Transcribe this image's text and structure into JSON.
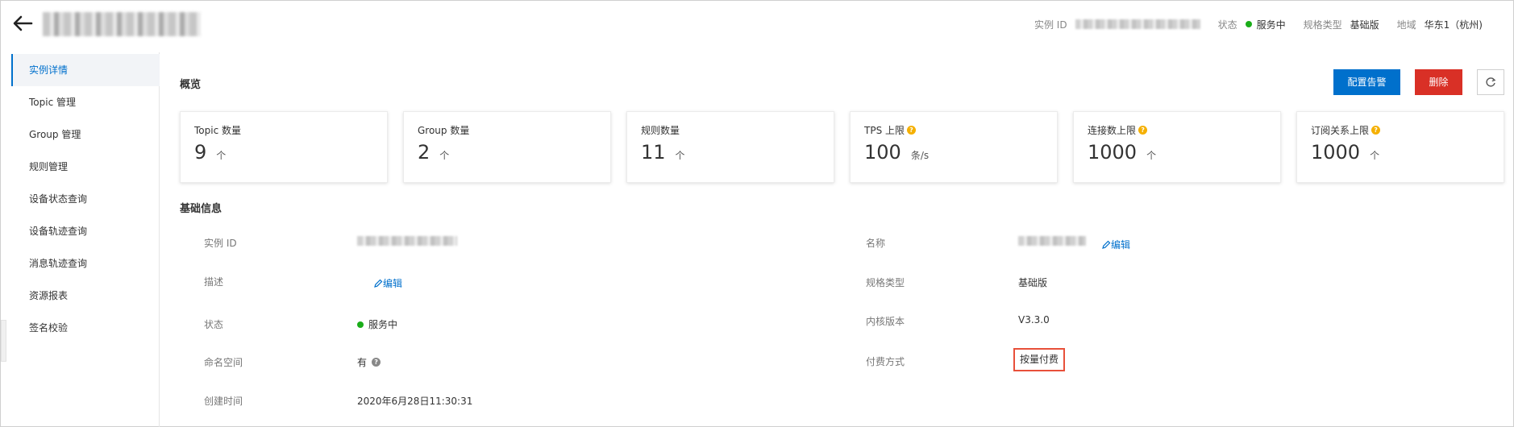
{
  "header": {
    "back_icon": "arrow-left-icon",
    "meta": {
      "instance_id_label": "实例 ID",
      "status_label": "状态",
      "status_value": "服务中",
      "status_color": "#1aad19",
      "spec_label": "规格类型",
      "spec_value": "基础版",
      "region_label": "地域",
      "region_value": "华东1（杭州)"
    }
  },
  "sidebar": {
    "items": [
      {
        "label": "实例详情",
        "active": true
      },
      {
        "label": "Topic 管理"
      },
      {
        "label": "Group 管理"
      },
      {
        "label": "规则管理"
      },
      {
        "label": "设备状态查询"
      },
      {
        "label": "设备轨迹查询"
      },
      {
        "label": "消息轨迹查询"
      },
      {
        "label": "资源报表"
      },
      {
        "label": "签名校验"
      }
    ]
  },
  "overview": {
    "title": "概览",
    "buttons": {
      "alert": "配置告警",
      "delete": "删除",
      "refresh_icon": "refresh-icon"
    },
    "accent_blue": "#0070cc",
    "danger_red": "#d93026",
    "stats": [
      {
        "label": "Topic 数量",
        "value": "9",
        "unit": "个",
        "help": false
      },
      {
        "label": "Group 数量",
        "value": "2",
        "unit": "个",
        "help": false
      },
      {
        "label": "规则数量",
        "value": "11",
        "unit": "个",
        "help": false
      },
      {
        "label": "TPS 上限",
        "value": "100",
        "unit": "条/s",
        "help": true
      },
      {
        "label": "连接数上限",
        "value": "1000",
        "unit": "个",
        "help": true
      },
      {
        "label": "订阅关系上限",
        "value": "1000",
        "unit": "个",
        "help": true
      }
    ]
  },
  "basic_info": {
    "title": "基础信息",
    "edit_label": "编辑",
    "instance_id_label": "实例 ID",
    "description_label": "描述",
    "status_label": "状态",
    "status_value": "服务中",
    "namespace_label": "命名空间",
    "namespace_value": "有",
    "created_label": "创建时间",
    "created_value": "2020年6月28日11:30:31",
    "name_label": "名称",
    "spec_label": "规格类型",
    "spec_value": "基础版",
    "kernel_label": "内核版本",
    "kernel_value": "V3.3.0",
    "billing_label": "付费方式",
    "billing_value": "按量付费",
    "highlight_color": "#e8503a"
  }
}
